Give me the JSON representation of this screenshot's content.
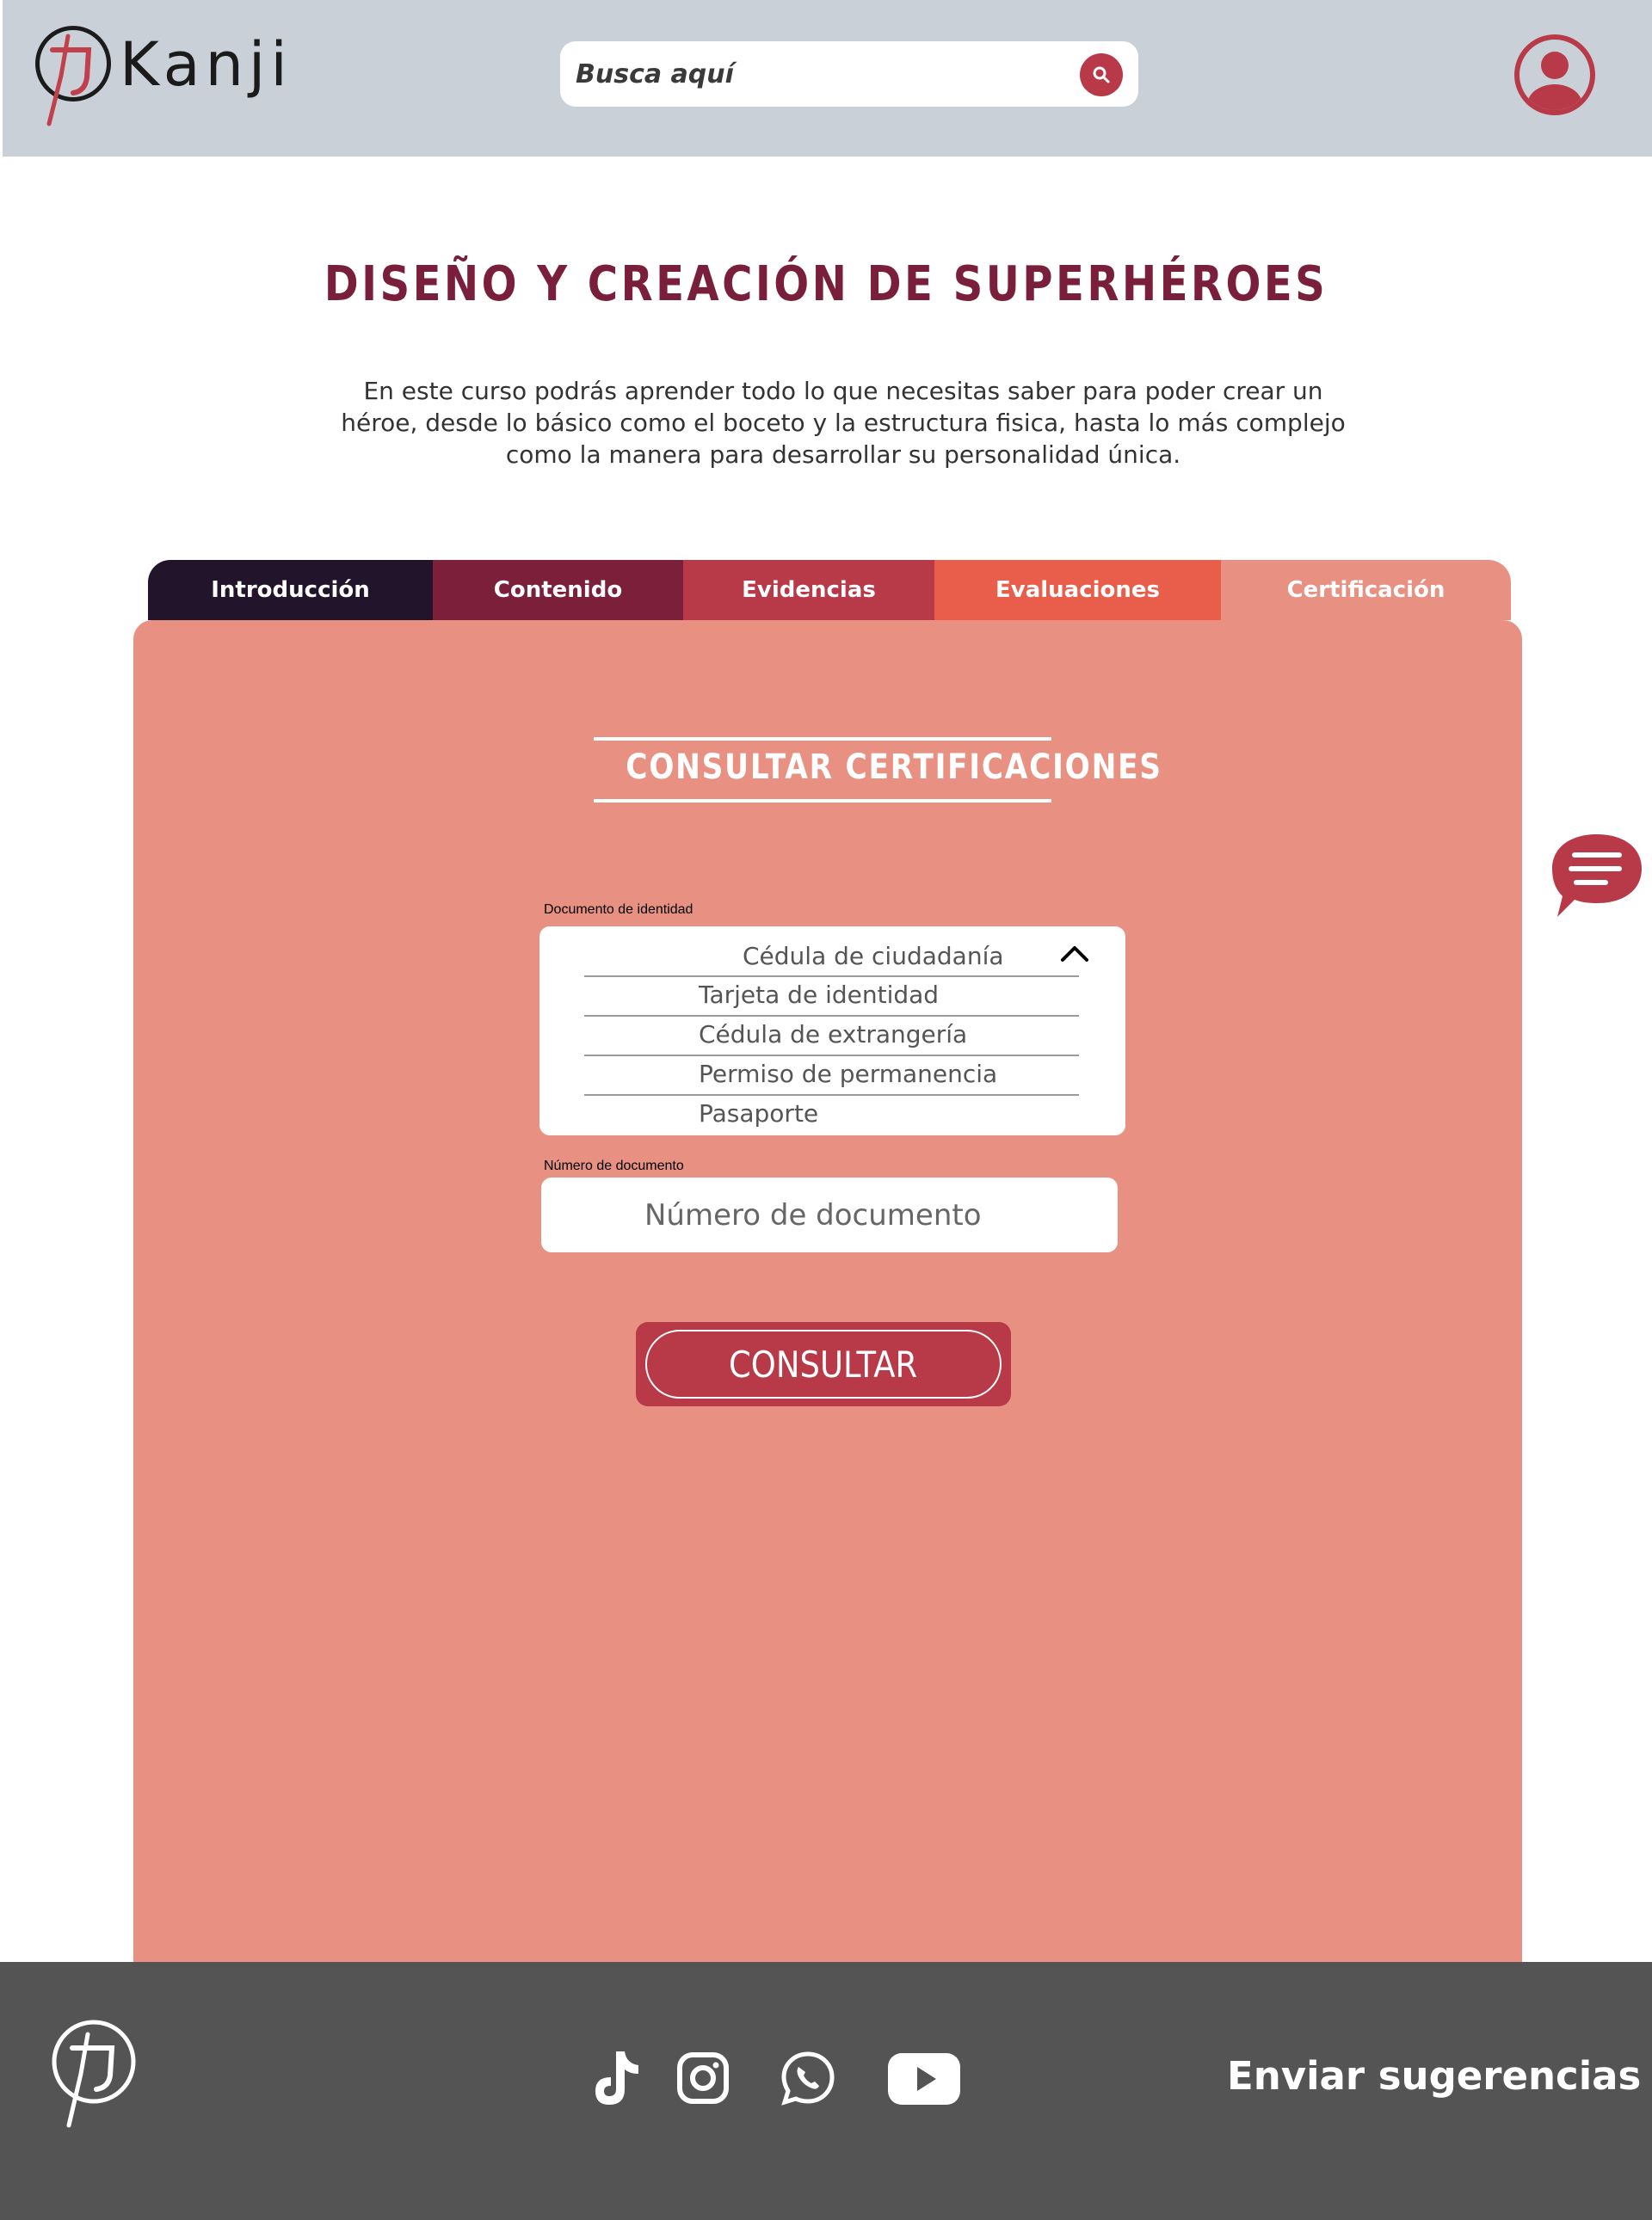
{
  "header": {
    "brand": "Kanji",
    "search": {
      "placeholder": "Busca aquí"
    }
  },
  "course": {
    "title": "DISEÑO Y CREACIÓN DE SUPERHÉROES",
    "description": "En este curso podrás aprender todo lo que necesitas saber para poder crear un héroe, desde lo básico como el boceto y la estructura fisica, hasta lo más complejo como la manera para desarrollar su personalidad única."
  },
  "tabs": [
    {
      "label": "Introducción",
      "color": "#22142b"
    },
    {
      "label": "Contenido",
      "color": "#7b1f3b"
    },
    {
      "label": "Evidencias",
      "color": "#b83a48"
    },
    {
      "label": "Evaluaciones",
      "color": "#e95e4a"
    },
    {
      "label": "Certificación",
      "color": "#e89183",
      "active": true
    }
  ],
  "panel": {
    "heading": "CONSULTAR CERTIFICACIONES",
    "document_type": {
      "label": "Documento de identidad",
      "selected": "Cédula de ciudadanía",
      "options": [
        "Tarjeta de identidad",
        "Cédula de extrangería",
        "Permiso de permanencia",
        "Pasaporte"
      ]
    },
    "document_number": {
      "label": "Número de documento",
      "placeholder": "Número de documento"
    },
    "submit_label": "CONSULTAR"
  },
  "footer": {
    "social": [
      "tiktok-icon",
      "instagram-icon",
      "whatsapp-icon",
      "youtube-icon"
    ],
    "suggestions_label": "Enviar sugerencias"
  },
  "colors": {
    "brand_red": "#b83a48",
    "title_maroon": "#7a1f3b",
    "panel_salmon": "#e89183",
    "header_gray": "#c9d0d7",
    "footer_gray": "#545454"
  }
}
